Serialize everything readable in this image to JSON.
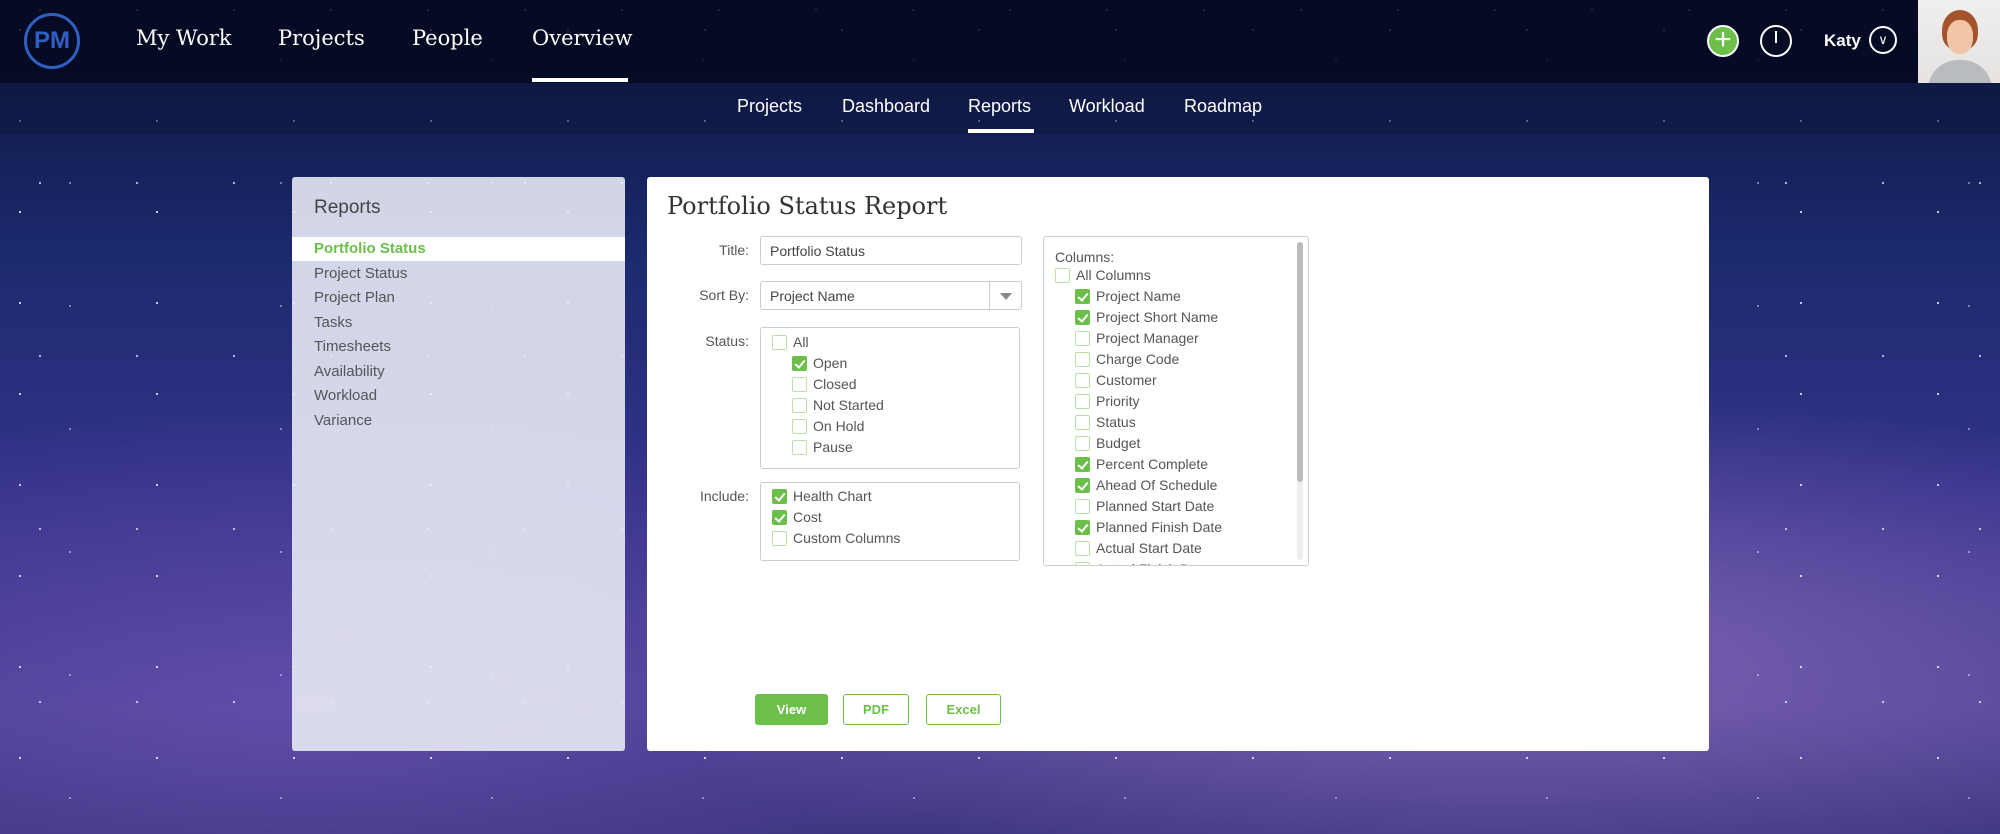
{
  "topnav": {
    "logo": "PM",
    "items": [
      "My Work",
      "Projects",
      "People",
      "Overview"
    ],
    "active": "Overview",
    "user": "Katy",
    "icons": [
      "plus-icon",
      "timer-icon",
      "chevron-down-icon"
    ]
  },
  "subnav": {
    "items": [
      "Projects",
      "Dashboard",
      "Reports",
      "Workload",
      "Roadmap"
    ],
    "active": "Reports"
  },
  "sidebar": {
    "title": "Reports",
    "items": [
      "Portfolio Status",
      "Project Status",
      "Project Plan",
      "Tasks",
      "Timesheets",
      "Availability",
      "Workload",
      "Variance"
    ],
    "active": "Portfolio Status"
  },
  "form": {
    "heading": "Portfolio Status Report",
    "title_label": "Title:",
    "title_value": "Portfolio Status",
    "sort_label": "Sort By:",
    "sort_value": "Project Name",
    "status_label": "Status:",
    "status": [
      {
        "label": "All",
        "checked": false
      },
      {
        "label": "Open",
        "checked": true
      },
      {
        "label": "Closed",
        "checked": false
      },
      {
        "label": "Not Started",
        "checked": false
      },
      {
        "label": "On Hold",
        "checked": false
      },
      {
        "label": "Pause",
        "checked": false
      }
    ],
    "include_label": "Include:",
    "include": [
      {
        "label": "Health Chart",
        "checked": true
      },
      {
        "label": "Cost",
        "checked": true
      },
      {
        "label": "Custom Columns",
        "checked": false
      }
    ],
    "columns_label": "Columns:",
    "columns": [
      {
        "label": "All Columns",
        "checked": false
      },
      {
        "label": "Project Name",
        "checked": true
      },
      {
        "label": "Project Short Name",
        "checked": true
      },
      {
        "label": "Project Manager",
        "checked": false
      },
      {
        "label": "Charge Code",
        "checked": false
      },
      {
        "label": "Customer",
        "checked": false
      },
      {
        "label": "Priority",
        "checked": false
      },
      {
        "label": "Status",
        "checked": false
      },
      {
        "label": "Budget",
        "checked": false
      },
      {
        "label": "Percent Complete",
        "checked": true
      },
      {
        "label": "Ahead Of Schedule",
        "checked": true
      },
      {
        "label": "Planned Start Date",
        "checked": false
      },
      {
        "label": "Planned Finish Date",
        "checked": true
      },
      {
        "label": "Actual Start Date",
        "checked": false
      },
      {
        "label": "Actual Finish Date",
        "checked": false
      }
    ],
    "buttons": {
      "view": "View",
      "pdf": "PDF",
      "excel": "Excel"
    }
  },
  "colors": {
    "accent": "#6cc04a",
    "logo": "#2f5fc4"
  }
}
